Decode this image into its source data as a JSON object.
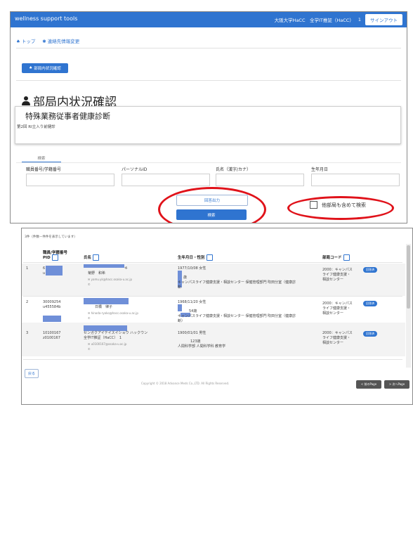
{
  "header": {
    "app_title": "wellness support tools",
    "user_org": "大阪大学HaCC　全学IT推証（HaCC）",
    "user_sep": "1",
    "signout_label": "サインアウト"
  },
  "breadcrumb": {
    "home_label": "トップ",
    "contact_label": "連絡先情報変更"
  },
  "status_button_label": "部局内状況確認",
  "page_title": "部局内状況確認",
  "panel": {
    "title": "特殊業務従事者健康診断",
    "subtitle": "第2回 RI立入り前健診"
  },
  "search_tab_label": "検索",
  "form": {
    "fields": [
      {
        "label": "職員番号/学籍番号",
        "value": ""
      },
      {
        "label": "パーソナルID",
        "value": ""
      },
      {
        "label": "氏名（漢字/カナ）",
        "value": ""
      },
      {
        "label": "生年月日",
        "value": ""
      }
    ],
    "csv_button_label": "回答出力",
    "search_button_label": "検索",
    "include_other_label": "他部局も含めて検索"
  },
  "results": {
    "count_text": "3件（件数—件件を表示しています）",
    "headers": {
      "id_top": "職員/学籍番号",
      "id_bottom": "PID",
      "name": "氏名",
      "birth": "生年月日・性別",
      "dept": "部局コード"
    },
    "rows": [
      {
        "no": "1",
        "id1": "6",
        "id2": "u",
        "name_kana": "キ",
        "name": "菊野　和希",
        "email": "✉ yamu.yk@hacc.osaka-u.ac.jp",
        "phone": "✆",
        "birth": "1977/10/08 女性",
        "age": "歳",
        "affil": "キャンパスライフ健康支援・相談センター 保健管理部門 吹田分室（健康診",
        "affil2": "新",
        "dept1": "2000：キャンパス",
        "dept2": "ライフ健康支援・",
        "dept3": "相談センター",
        "badge": "回答済"
      },
      {
        "no": "2",
        "id1": "30009254",
        "id2": "u455584b",
        "name_kana": "",
        "name": "日橋　律子",
        "email": "✉ hinoda-ryoko@hacc.osaka-u.ac.jp",
        "phone": "✆",
        "birth": "1968/11/20 女性",
        "age": "54歳",
        "affil": "キャンパスライフ健康支援・相談センター 保健管理部門 吹田分室（健康診",
        "affil2": "断）",
        "dept1": "2000：キャンパス",
        "dept2": "ライフ健康支援・",
        "dept3": "相談センター",
        "badge": "回答済"
      },
      {
        "no": "3",
        "id1": "10100167",
        "id2": "z0100167",
        "name_kana": "センガクアイテイスイショウ ハックウン",
        "name": "全学IT推証（HaCC）　1",
        "email": "✉ u0100167@osaka-u.ac.jp",
        "phone": "✆",
        "birth": "1900/01/01 男性",
        "age": "123歳",
        "affil": "人間科学部 人間科学科 教育学",
        "affil2": "",
        "dept1": "2000：キャンパス",
        "dept2": "ライフ健康支援・",
        "dept3": "相談センター",
        "badge": "回答済"
      }
    ],
    "back_label": "戻る",
    "copyright": "Copyright © 2018 Advance Meds Co.,LTD. All Rights Reserved.",
    "prev_label": "< 前のPage",
    "next_label": "> 次へPage"
  },
  "colors": {
    "accent": "#2f74d0",
    "highlight": "#e0121a",
    "redaction": "#6f8fd8"
  }
}
